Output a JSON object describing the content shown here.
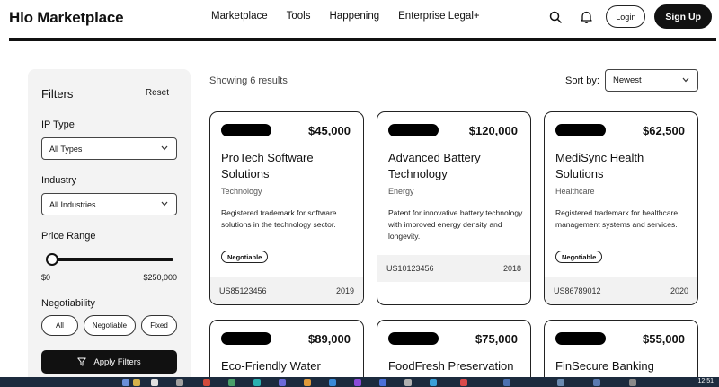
{
  "header": {
    "brand": "Hlo Marketplace",
    "nav": [
      "Marketplace",
      "Tools",
      "Happening",
      "Enterprise Legal+"
    ],
    "login_label": "Login",
    "signup_label": "Sign Up"
  },
  "filters": {
    "title": "Filters",
    "reset_label": "Reset",
    "ip_type_label": "IP Type",
    "ip_type_value": "All Types",
    "industry_label": "Industry",
    "industry_value": "All Industries",
    "price_label": "Price Range",
    "price_min": "$0",
    "price_max": "$250,000",
    "price_slider_value": 0,
    "negotiability_label": "Negotiability",
    "negotiability_options": [
      "All",
      "Negotiable",
      "Fixed"
    ],
    "apply_label": "Apply Filters"
  },
  "results": {
    "showing_text": "Showing 6 results",
    "sort_label": "Sort by:",
    "sort_value": "Newest"
  },
  "cards": [
    {
      "price": "$45,000",
      "title": "ProTech Software Solutions",
      "category": "Technology",
      "description": "Registered trademark for software solutions in the technology sector.",
      "badge": "Negotiable",
      "id": "US85123456",
      "year": "2019"
    },
    {
      "price": "$120,000",
      "title": "Advanced Battery Technology",
      "category": "Energy",
      "description": "Patent for innovative battery technology with improved energy density and longevity.",
      "badge": "",
      "id": "US10123456",
      "year": "2018"
    },
    {
      "price": "$62,500",
      "title": "MediSync Health Solutions",
      "category": "Healthcare",
      "description": "Registered trademark for healthcare management systems and services.",
      "badge": "Negotiable",
      "id": "US86789012",
      "year": "2020"
    },
    {
      "price": "$89,000",
      "title": "Eco-Friendly Water",
      "category": "",
      "description": "",
      "badge": "",
      "id": "",
      "year": ""
    },
    {
      "price": "$75,000",
      "title": "FoodFresh Preservation",
      "category": "",
      "description": "",
      "badge": "",
      "id": "",
      "year": ""
    },
    {
      "price": "$55,000",
      "title": "FinSecure Banking",
      "category": "",
      "description": "",
      "badge": "",
      "id": "",
      "year": ""
    }
  ],
  "taskbar": {
    "clock": "12:51"
  }
}
